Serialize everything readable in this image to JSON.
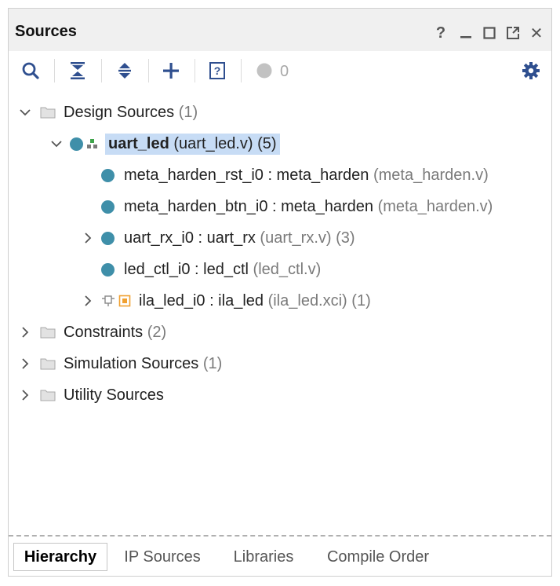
{
  "panel": {
    "title": "Sources"
  },
  "window_controls": [
    {
      "name": "help",
      "icon": "help-icon",
      "glyph": "?"
    },
    {
      "name": "minimize",
      "icon": "minimize-icon"
    },
    {
      "name": "maximize",
      "icon": "maximize-icon"
    },
    {
      "name": "float",
      "icon": "float-icon"
    },
    {
      "name": "close",
      "icon": "close-icon",
      "glyph": "✕"
    }
  ],
  "toolbar": {
    "buttons": [
      "search-icon",
      "collapse-all-icon",
      "expand-all-icon",
      "add-icon",
      "properties-icon"
    ],
    "status_count": "0",
    "settings_icon": "gear-icon"
  },
  "colors": {
    "accent": "#2f4f8f",
    "module_dot": "#3f8fa9",
    "selection": "#c7dcf5",
    "ip_orange": "#f0a030"
  },
  "tree": {
    "design_sources": {
      "label": "Design Sources",
      "count": "(1)",
      "expanded": true
    },
    "top_module": {
      "name": "uart_led",
      "file": "(uart_led.v)",
      "count": "(5)",
      "expanded": true,
      "selected": true
    },
    "children": [
      {
        "instance": "meta_harden_rst_i0 : meta_harden",
        "file": "(meta_harden.v)",
        "count": "",
        "expandable": false,
        "kind": "module"
      },
      {
        "instance": "meta_harden_btn_i0 : meta_harden",
        "file": "(meta_harden.v)",
        "count": "",
        "expandable": false,
        "kind": "module"
      },
      {
        "instance": "uart_rx_i0 : uart_rx",
        "file": "(uart_rx.v)",
        "count": "(3)",
        "expandable": true,
        "kind": "module"
      },
      {
        "instance": "led_ctl_i0 : led_ctl",
        "file": "(led_ctl.v)",
        "count": "",
        "expandable": false,
        "kind": "module"
      },
      {
        "instance": "ila_led_i0 : ila_led",
        "file": "(ila_led.xci)",
        "count": "(1)",
        "expandable": true,
        "kind": "ip"
      }
    ],
    "constraints": {
      "label": "Constraints",
      "count": "(2)"
    },
    "simulation_sources": {
      "label": "Simulation Sources",
      "count": "(1)"
    },
    "utility_sources": {
      "label": "Utility Sources",
      "count": ""
    }
  },
  "tabs": [
    {
      "label": "Hierarchy",
      "active": true
    },
    {
      "label": "IP Sources",
      "active": false
    },
    {
      "label": "Libraries",
      "active": false
    },
    {
      "label": "Compile Order",
      "active": false
    }
  ]
}
